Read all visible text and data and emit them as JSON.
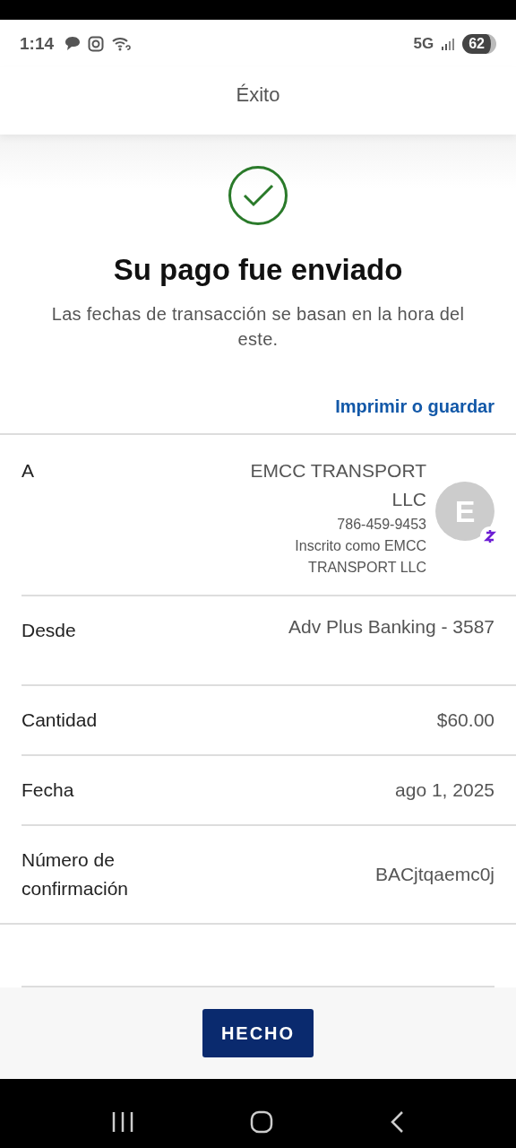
{
  "status_bar": {
    "time": "1:14",
    "network": "5G",
    "battery": "62"
  },
  "header": {
    "title": "Éxito"
  },
  "result": {
    "title": "Su pago fue enviado",
    "note": "Las fechas de transacción se basan en la hora del este.",
    "link": "Imprimir o guardar"
  },
  "recipient": {
    "label": "A",
    "name": "EMCC TRANSPORT LLC",
    "phone": "786-459-9453",
    "enrolled": "Inscrito como EMCC TRANSPORT LLC",
    "initial": "E"
  },
  "details": [
    {
      "label": "Desde",
      "value": "Adv Plus Banking - 3587",
      "tall": true
    },
    {
      "label": "Cantidad",
      "value": "$60.00",
      "tall": false
    },
    {
      "label": "Fecha",
      "value": "ago 1, 2025",
      "tall": false
    },
    {
      "label": "Número de confirmación",
      "value": "BACjtqaemc0j",
      "tall": false
    }
  ],
  "footer": {
    "button": "HECHO"
  }
}
